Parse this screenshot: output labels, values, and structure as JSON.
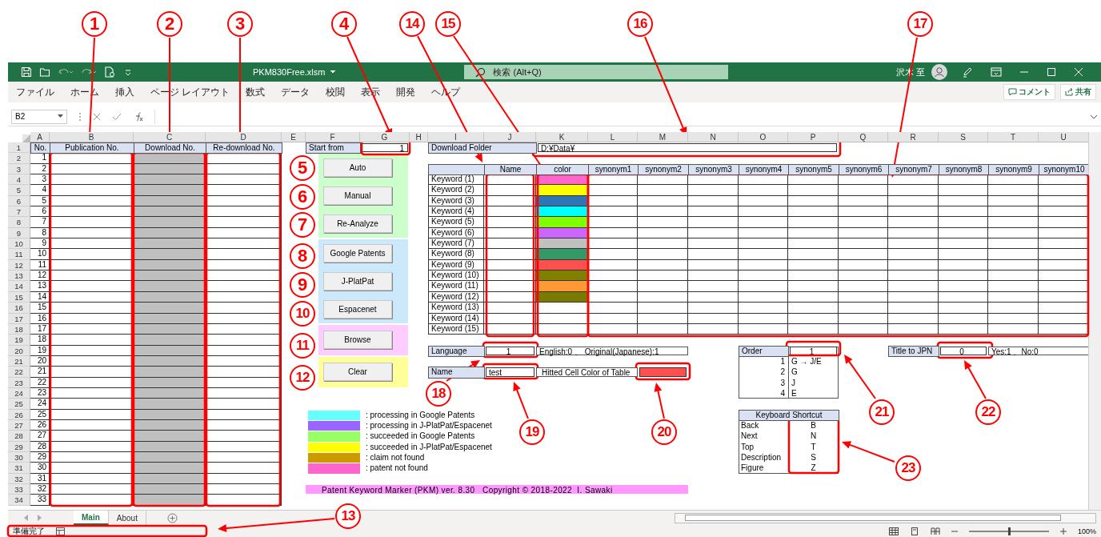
{
  "title_bar": {
    "file_name": "PKM830Free.xlsm",
    "search": {
      "placeholder": "検索 (Alt+Q)"
    },
    "user_name": "沢木 至"
  },
  "ribbon_tabs": [
    "ファイル",
    "ホーム",
    "挿入",
    "ページ レイアウト",
    "数式",
    "データ",
    "校閲",
    "表示",
    "開発",
    "ヘルプ"
  ],
  "ribbon_buttons": {
    "comment": "コメント",
    "share": "共有"
  },
  "formula_bar": {
    "name_box": "B2"
  },
  "column_headers": [
    "A",
    "B",
    "C",
    "D",
    "E",
    "F",
    "G",
    "H",
    "I",
    "J",
    "K",
    "L",
    "M",
    "N",
    "O",
    "P",
    "Q",
    "R",
    "S",
    "T",
    "U"
  ],
  "row_numbers": [
    "1",
    "2",
    "3",
    "4",
    "5",
    "6",
    "7",
    "8",
    "9",
    "10",
    "11",
    "12",
    "13",
    "14",
    "15",
    "16",
    "17",
    "18",
    "19",
    "20",
    "21",
    "22",
    "23",
    "24",
    "25",
    "26",
    "27",
    "28",
    "29",
    "30",
    "31",
    "32",
    "33",
    "34"
  ],
  "list_table": {
    "columns": [
      "No.",
      "Publication No.",
      "Download No.",
      "Re-download No."
    ],
    "numbers": [
      "1",
      "2",
      "3",
      "4",
      "5",
      "6",
      "7",
      "8",
      "9",
      "10",
      "11",
      "12",
      "13",
      "14",
      "15",
      "16",
      "17",
      "18",
      "19",
      "20",
      "21",
      "22",
      "23",
      "24",
      "25",
      "26",
      "27",
      "28",
      "29",
      "30",
      "31",
      "32",
      "33"
    ]
  },
  "start_from": {
    "label": "Start from",
    "value": "1"
  },
  "button_panels": [
    {
      "color": "#ccffcc",
      "buttons": [
        "Auto",
        "Manual",
        "Re-Analyze"
      ]
    },
    {
      "color": "#cce8fb",
      "buttons": [
        "Google Patents",
        "J-PlatPat",
        "Espacenet"
      ]
    },
    {
      "color": "#ffccff",
      "buttons": [
        "Browse"
      ]
    },
    {
      "color": "#ffff99",
      "buttons": [
        "Clear"
      ]
    }
  ],
  "download_folder": {
    "label": "Download Folder",
    "value": "D:¥Data¥"
  },
  "keyword_table": {
    "columns": [
      "Name",
      "color",
      "synonym1",
      "synonym2",
      "synonym3",
      "synonym4",
      "synonym5",
      "synonym6",
      "synonym7",
      "synonym8",
      "synonym9",
      "synonym10"
    ],
    "rows": [
      {
        "label": "Keyword (1)",
        "color": "#ff66cc"
      },
      {
        "label": "Keyword (2)",
        "color": "#ffff00"
      },
      {
        "label": "Keyword (3)",
        "color": "#2e75b6"
      },
      {
        "label": "Keyword (4)",
        "color": "#00ffff"
      },
      {
        "label": "Keyword (5)",
        "color": "#80ff00"
      },
      {
        "label": "Keyword (6)",
        "color": "#cc66ff"
      },
      {
        "label": "Keyword (7)",
        "color": "#c0c0c0"
      },
      {
        "label": "Keyword (8)",
        "color": "#339966"
      },
      {
        "label": "Keyword (9)",
        "color": "#ff5050"
      },
      {
        "label": "Keyword (10)",
        "color": "#808000"
      },
      {
        "label": "Keyword (11)",
        "color": "#ff9933"
      },
      {
        "label": "Keyword (12)",
        "color": "#7a7a00"
      },
      {
        "label": "Keyword (13)"
      },
      {
        "label": "Keyword (14)"
      },
      {
        "label": "Keyword (15)"
      }
    ]
  },
  "language": {
    "label": "Language",
    "value": "1",
    "hint": "English:0 、 Original(Japanese):1"
  },
  "name_setting": {
    "label": "Name",
    "value": "test",
    "color_label": "Hitted Cell Color of Table",
    "hit_cell": {
      "color": "#ff5050"
    }
  },
  "order": {
    "label": "Order",
    "value": "1",
    "options": [
      {
        "number": "1",
        "text": "G → J/E"
      },
      {
        "number": "2",
        "text": "G"
      },
      {
        "number": "3",
        "text": "J"
      },
      {
        "number": "4",
        "text": "E"
      }
    ]
  },
  "title_to_jpn": {
    "label": "Title to JPN",
    "value": "0",
    "hint": "Yes:1 、No:0"
  },
  "legend": [
    {
      "color": "#66ffff",
      "text": ": processing in Google Patents"
    },
    {
      "color": "#9966ff",
      "text": ": processing in J-PlatPat/Espacenet"
    },
    {
      "color": "#99ff66",
      "text": ": succeeded in Google Patents"
    },
    {
      "color": "#ffff00",
      "text": ": succeeded in J-PlatPat/Espacenet"
    },
    {
      "color": "#cc9900",
      "text": ": claim not found"
    },
    {
      "color": "#ff66cc",
      "text": ": patent not found"
    }
  ],
  "banner": "Patent Keyword Marker (PKM) ver. 8.30   Copyright © 2018-2022  I. Sawaki",
  "keyboard_shortcut": {
    "title": "Keyboard Shortcut",
    "items": [
      {
        "action": "Back",
        "key": "B"
      },
      {
        "action": "Next",
        "key": "N"
      },
      {
        "action": "Top",
        "key": "T"
      },
      {
        "action": "Description",
        "key": "S"
      },
      {
        "action": "Figure",
        "key": "Z"
      }
    ]
  },
  "sheet_tabs": [
    {
      "label": "Main",
      "selected": true
    },
    {
      "label": "About",
      "selected": false
    }
  ],
  "status_bar": {
    "text": "準備完了",
    "zoom": "100%",
    "zoom_slider": {
      "level": 0.5
    }
  },
  "callouts": [
    "1",
    "2",
    "3",
    "4",
    "14",
    "15",
    "16",
    "17",
    "5",
    "6",
    "7",
    "8",
    "9",
    "10",
    "11",
    "12",
    "13",
    "18",
    "19",
    "20",
    "21",
    "22",
    "23"
  ]
}
